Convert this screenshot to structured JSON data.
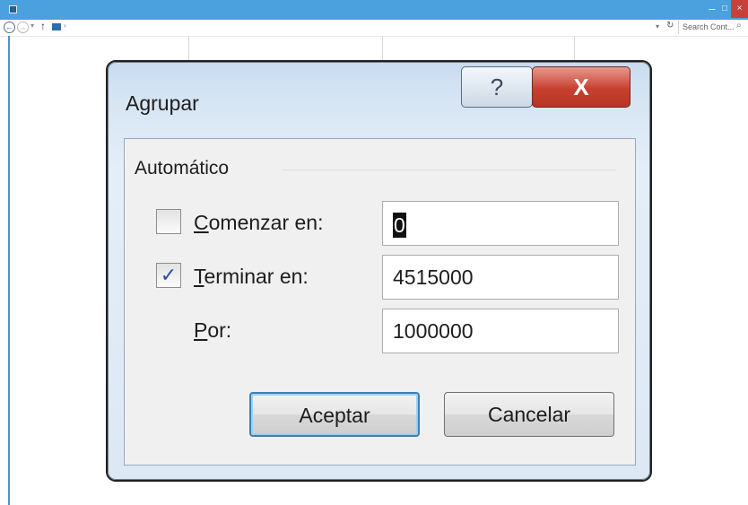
{
  "window": {
    "search_placeholder": "Search Cont...",
    "minimize": "–",
    "maximize": "□",
    "close": "×"
  },
  "dialog": {
    "title": "Agrupar",
    "help_glyph": "?",
    "close_glyph": "X",
    "group_label": "Automático",
    "fields": [
      {
        "label_accel": "C",
        "label_rest": "omenzar en:",
        "checked": false,
        "value": "0"
      },
      {
        "label_accel": "T",
        "label_rest": "erminar en:",
        "checked": true,
        "value": "4515000"
      },
      {
        "label_accel": "P",
        "label_rest": "or:",
        "value": "1000000"
      }
    ],
    "ok_label": "Aceptar",
    "cancel_label": "Cancelar"
  }
}
